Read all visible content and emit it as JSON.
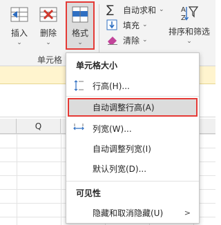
{
  "ribbon": {
    "insert_label": "插入",
    "delete_label": "删除",
    "format_label": "格式",
    "group_label": "单元格",
    "autosum_label": "自动求和",
    "fill_label": "填充",
    "clear_label": "清除",
    "sort_filter_label": "排序和筛选",
    "sigma_glyph": "∑",
    "dropdown_glyph": "⌄",
    "accent": "#e53935"
  },
  "sheet": {
    "column_header": "Q"
  },
  "menu": {
    "cell_size_header": "单元格大小",
    "items": [
      {
        "label": "行高(H)...",
        "icon": "row-height-icon"
      },
      {
        "label": "自动调整行高(A)",
        "highlighted": true
      },
      {
        "label": "列宽(W)...",
        "icon": "column-width-icon"
      },
      {
        "label": "自动调整列宽(I)"
      },
      {
        "label": "默认列宽(D)..."
      }
    ],
    "visibility_header": "可见性",
    "hide_unhide_label": "隐藏和取消隐藏(U)",
    "submenu_arrow": ">"
  }
}
